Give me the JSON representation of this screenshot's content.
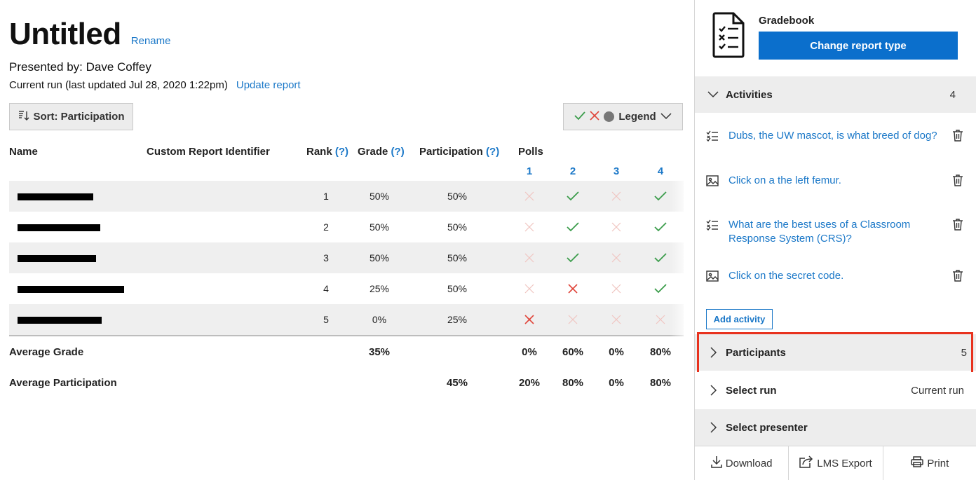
{
  "report": {
    "title": "Untitled",
    "rename_label": "Rename",
    "presented_by": "Presented by: Dave Coffey",
    "current_run": "Current run (last updated Jul 28, 2020 1:22pm)",
    "update_label": "Update report"
  },
  "toolbar": {
    "sort_label": "Sort: Participation",
    "legend_label": "Legend"
  },
  "table": {
    "headers": {
      "name": "Name",
      "custom_id": "Custom Report Identifier",
      "rank": "Rank",
      "grade": "Grade",
      "participation": "Participation",
      "polls": "Polls",
      "help": "(?)"
    },
    "poll_numbers": [
      "1",
      "2",
      "3",
      "4"
    ],
    "rows": [
      {
        "rank": "1",
        "grade": "50%",
        "participation": "50%",
        "polls": [
          "absent",
          "correct",
          "absent",
          "correct"
        ]
      },
      {
        "rank": "2",
        "grade": "50%",
        "participation": "50%",
        "polls": [
          "absent",
          "correct",
          "absent",
          "correct"
        ]
      },
      {
        "rank": "3",
        "grade": "50%",
        "participation": "50%",
        "polls": [
          "absent",
          "correct",
          "absent",
          "correct"
        ]
      },
      {
        "rank": "4",
        "grade": "25%",
        "participation": "50%",
        "polls": [
          "absent",
          "incorrect",
          "absent",
          "correct"
        ]
      },
      {
        "rank": "5",
        "grade": "0%",
        "participation": "25%",
        "polls": [
          "incorrect",
          "absent",
          "absent",
          "absent"
        ]
      }
    ],
    "average_grade": {
      "label": "Average Grade",
      "grade": "35%",
      "polls": [
        "0%",
        "60%",
        "0%",
        "80%"
      ]
    },
    "average_participation": {
      "label": "Average Participation",
      "participation": "45%",
      "polls": [
        "20%",
        "80%",
        "0%",
        "80%"
      ]
    }
  },
  "panel": {
    "report_type": "Gradebook",
    "change_label": "Change report type",
    "activities": {
      "label": "Activities",
      "count": "4",
      "items": [
        {
          "text": "Dubs, the UW mascot, is what breed of dog?",
          "icon": "list-icon"
        },
        {
          "text": "Click on a the left femur.",
          "icon": "image-icon"
        },
        {
          "text": "What are the best uses of a Classroom Response System (CRS)?",
          "icon": "list-icon"
        },
        {
          "text": "Click on the secret code.",
          "icon": "image-icon"
        }
      ],
      "add_label": "Add activity"
    },
    "participants": {
      "label": "Participants",
      "count": "5"
    },
    "select_run": {
      "label": "Select run",
      "value": "Current run"
    },
    "select_presenter": {
      "label": "Select presenter"
    },
    "footer": {
      "download": "Download",
      "lms_export": "LMS Export",
      "print": "Print"
    }
  },
  "colors": {
    "accent": "#1b78c8",
    "primary_button": "#0b6fcc",
    "correct": "#3a9c4a",
    "incorrect": "#e0453a",
    "highlight": "#e8321e"
  }
}
